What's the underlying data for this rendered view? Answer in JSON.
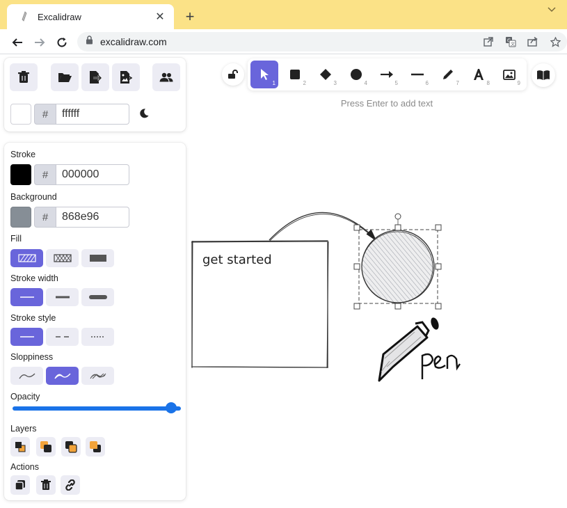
{
  "browser": {
    "tab_title": "Excalidraw",
    "url": "excalidraw.com"
  },
  "top_panel": {
    "canvas_hex": "ffffff"
  },
  "properties": {
    "stroke_label": "Stroke",
    "stroke_hex": "000000",
    "background_label": "Background",
    "background_hex": "868e96",
    "fill_label": "Fill",
    "stroke_width_label": "Stroke width",
    "stroke_style_label": "Stroke style",
    "sloppiness_label": "Sloppiness",
    "opacity_label": "Opacity",
    "opacity_value": 100,
    "layers_label": "Layers",
    "actions_label": "Actions",
    "hash": "#"
  },
  "tools": {
    "numbers": [
      "1",
      "2",
      "3",
      "4",
      "5",
      "6",
      "7",
      "8",
      "9"
    ],
    "selected": "selection"
  },
  "hint": "Press Enter to add text",
  "canvas": {
    "rectangle_text": "get started",
    "pen_text": "pen"
  },
  "colors": {
    "accent": "#6965db",
    "tab_bar": "#fbe287",
    "stroke": "#000000",
    "background": "#868e96"
  }
}
